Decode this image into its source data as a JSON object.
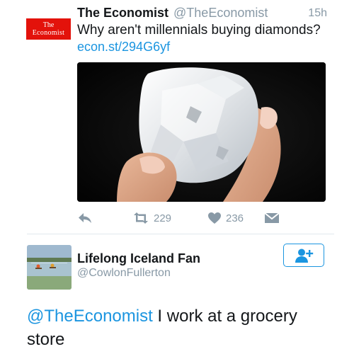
{
  "tweet": {
    "avatar_line1": "The",
    "avatar_line2": "Economist",
    "author_name": "The Economist",
    "author_handle": "@TheEconomist",
    "time": "15h",
    "text": "Why aren't millennials buying diamonds?",
    "link": "econ.st/294G6yf",
    "media_icon": "diamond-photo",
    "actions": {
      "reply_icon": "reply-icon",
      "retweet_icon": "retweet-icon",
      "retweet_count": "229",
      "like_icon": "heart-icon",
      "like_count": "236",
      "dm_icon": "envelope-icon"
    }
  },
  "reply_user": {
    "name": "Lifelong Iceland Fan",
    "handle": "@CowlonFullerton",
    "follow_icon": "add-user-icon"
  },
  "reply": {
    "mention": "@TheEconomist",
    "text": " I work at a grocery store"
  },
  "colors": {
    "link_blue": "#1b95e0",
    "muted_gray": "#8899a6",
    "economist_red": "#e3120b"
  }
}
